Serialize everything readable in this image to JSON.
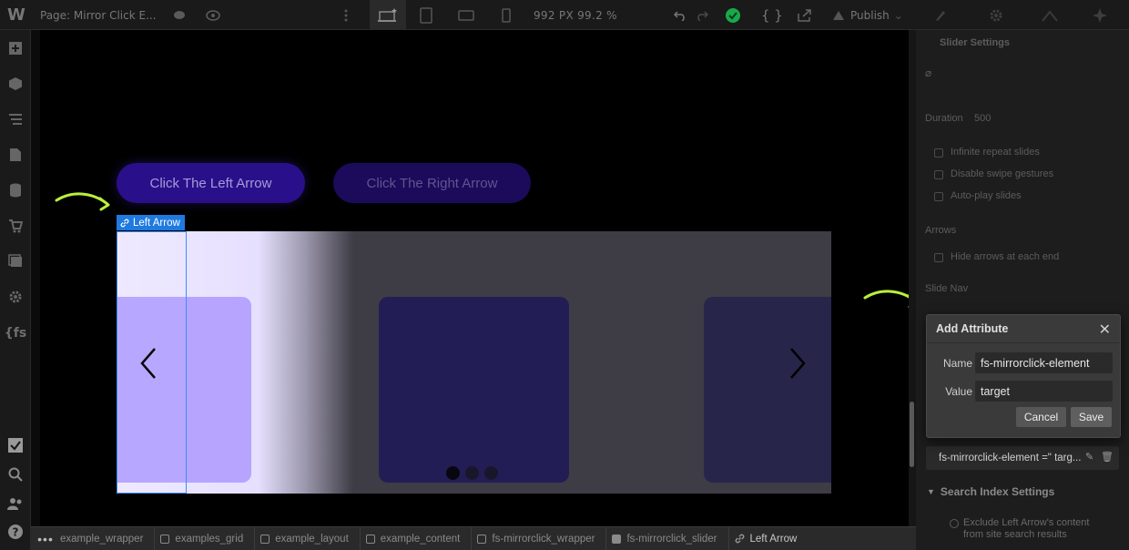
{
  "topbar": {
    "page_label": "Page: Mirror Click E...",
    "canvas_size": "992 PX  99.2 %",
    "publish_label": "Publish"
  },
  "canvas": {
    "button_left_label": "Click The Left Arrow",
    "button_right_label": "Click The Right Arrow",
    "selected_element_label": "Left Arrow",
    "slider_dots": 3,
    "active_dot": 0,
    "colors": {
      "doodle_arrow": "#b8f03c",
      "selection": "#3f8cff",
      "slide_active": "#b6a4ff"
    }
  },
  "breadcrumb": [
    {
      "label": "example_wrapper",
      "icon": "none"
    },
    {
      "label": "examples_grid",
      "icon": "square-icon"
    },
    {
      "label": "example_layout",
      "icon": "square-icon"
    },
    {
      "label": "example_content",
      "icon": "square-icon"
    },
    {
      "label": "fs-mirrorclick_wrapper",
      "icon": "square-icon"
    },
    {
      "label": "fs-mirrorclick_slider",
      "icon": "slider-icon"
    },
    {
      "label": "Left Arrow",
      "icon": "link-icon"
    }
  ],
  "panel": {
    "section_title": "Slider Settings",
    "duration_label": "Duration",
    "duration_value": "500",
    "opt_infinite": "Infinite repeat slides",
    "opt_swipe": "Disable swipe gestures",
    "opt_autoplay": "Auto-play slides",
    "arrows_heading": "Arrows",
    "opt_hide_arrows": "Hide arrows at each end",
    "slide_nav_heading": "Slide Nav",
    "attribute_row": "fs-mirrorclick-element =\" targ...",
    "search_index_heading": "Search Index Settings",
    "exclude_text_line1": "Exclude Left Arrow's content",
    "exclude_text_line2": "from site search results"
  },
  "dialog": {
    "title": "Add Attribute",
    "name_label": "Name",
    "name_value": "fs-mirrorclick-element",
    "value_label": "Value",
    "value_value": "target",
    "cancel_label": "Cancel",
    "save_label": "Save"
  }
}
